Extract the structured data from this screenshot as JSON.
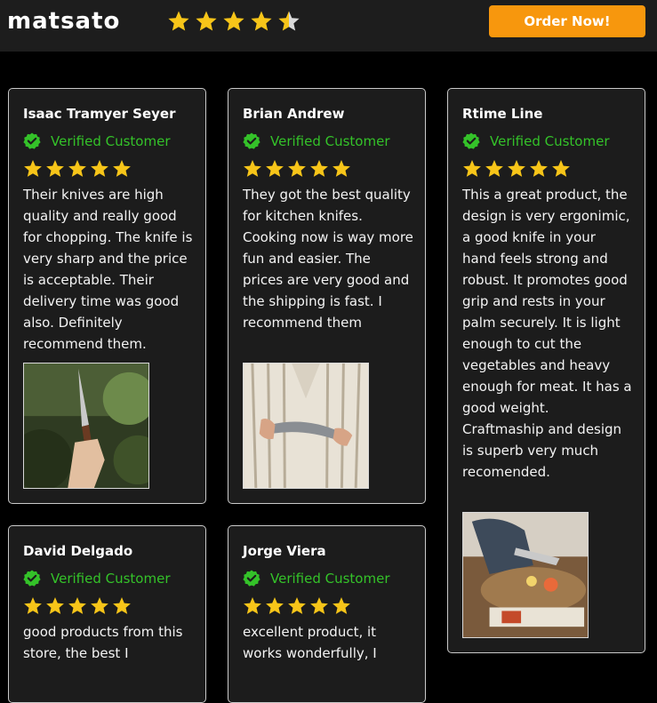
{
  "header": {
    "logo": "matsato",
    "rating_stars": 4.5,
    "order_button": "Order Now!"
  },
  "colors": {
    "star": "#f7c519",
    "accent": "#f7970d",
    "verified": "#34c229"
  },
  "reviews": [
    {
      "name": "Isaac Tramyer Seyer",
      "badge": "Verified Customer",
      "stars": 5,
      "text": "Their knives are high quality and really good for chopping. The knife is very sharp and the price is acceptable. Their delivery time was good also. Definitely recommend them.",
      "photo": "hand holding knife outdoors"
    },
    {
      "name": "Brian Andrew",
      "badge": "Verified Customer",
      "stars": 5,
      "text": "They got the best quality for kitchen knifes. Cooking now is way more fun and easier. The prices are very good and the shipping is fast. I recommend them",
      "photo": "hands holding knife over striped shirt"
    },
    {
      "name": "Rtime Line",
      "badge": "Verified Customer",
      "stars": 5,
      "text": "This a great product, the design is very ergonimic, a good knife in your hand feels strong and robust. It promotes good grip and rests in your palm securely. It is light enough to cut the vegetables and heavy enough for meat. It has a good weight. Craftmaship and design is superb very much recomended.",
      "photo": "knife cutting vegetables on board"
    },
    {
      "name": "David Delgado",
      "badge": "Verified Customer",
      "stars": 5,
      "text": "good products from this store, the best I"
    },
    {
      "name": "Jorge Viera",
      "badge": "Verified Customer",
      "stars": 5,
      "text": "excellent product, it works wonderfully, I"
    }
  ]
}
